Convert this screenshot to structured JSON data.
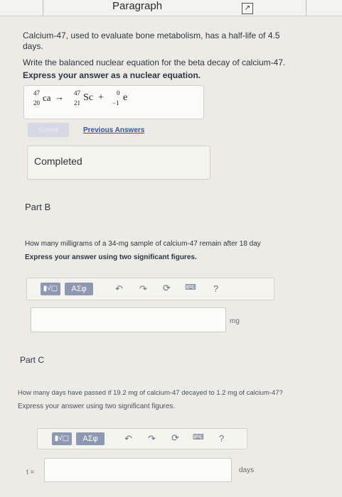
{
  "header": {
    "title": "Paragraph",
    "ext_icon": "external-link-icon"
  },
  "part_a": {
    "intro": "Calcium-47, used to evaluate bone metabolism, has a half-life of 4.5 days.",
    "question": "Write the balanced nuclear equation for the beta decay of calcium-47.",
    "instruction": "Express your answer as a nuclear equation.",
    "equation": {
      "reactant": {
        "mass": "47",
        "atomic": "20",
        "symbol": "ca"
      },
      "arrow": "→",
      "product": {
        "mass": "47",
        "atomic": "21",
        "symbol": "Sc"
      },
      "plus": "+",
      "particle": {
        "mass": "0",
        "atomic": "−1",
        "symbol": "e"
      }
    },
    "submit_label": "Submit",
    "previous_answers_label": "Previous Answers",
    "status": "Completed"
  },
  "part_b": {
    "label": "Part B",
    "question": "How many milligrams of a 34-mg sample of calcium-47 remain after 18 day",
    "instruction": "Express your answer using two significant figures.",
    "toolbar": {
      "templates": "▮√▢",
      "greek": "ΑΣφ",
      "help": "?"
    },
    "input_value": "",
    "unit": "mg"
  },
  "part_c": {
    "label": "Part C",
    "question": "How many days have passed if 19.2 mg of calcium-47 decayed to 1.2 mg of calcium-47?",
    "instruction": "Express your answer using two significant figures.",
    "toolbar": {
      "templates": "▮√▢",
      "greek": "ΑΣφ",
      "help": "?"
    },
    "variable": "t =",
    "input_value": "",
    "unit": "days"
  }
}
